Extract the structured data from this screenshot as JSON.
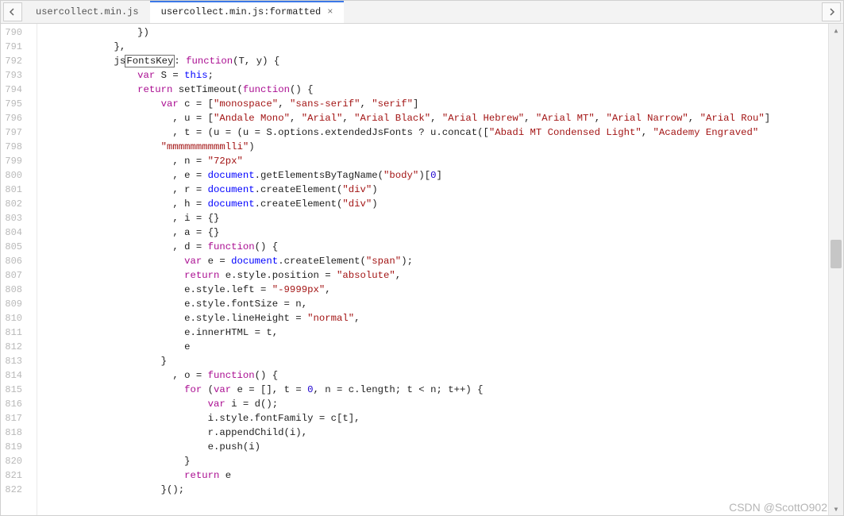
{
  "tabs": [
    {
      "label": "usercollect.min.js",
      "active": false
    },
    {
      "label": "usercollect.min.js:formatted",
      "active": true
    }
  ],
  "line_start": 790,
  "line_end": 822,
  "watermark": "CSDN @ScottO902",
  "code": {
    "fn_key": "FontsKey",
    "fn_prefix": "js",
    "fn_sig_open": ": ",
    "args": "(T, y)",
    "this_var": "S",
    "arr_base_fonts": [
      "monospace",
      "sans-serif",
      "serif"
    ],
    "arr_u_fonts_head": [
      "Andale Mono",
      "Arial",
      "Arial Black",
      "Arial Hebrew",
      "Arial MT",
      "Arial Narrow",
      "Arial Rou"
    ],
    "arr_concat_fonts_head": [
      "Abadi MT Condensed Light",
      "Academy Engraved"
    ],
    "options_path": "S.options.extendedJsFonts",
    "mmm_literal": "mmmmmmmmmmlli",
    "font_size": "72px",
    "body_tag": "body",
    "div_tag": "div",
    "span_tag": "span",
    "absolute": "absolute",
    "neg9999": "-9999px",
    "normal": "normal",
    "c_access": "c[t]",
    "loop_init_zero": "0"
  }
}
